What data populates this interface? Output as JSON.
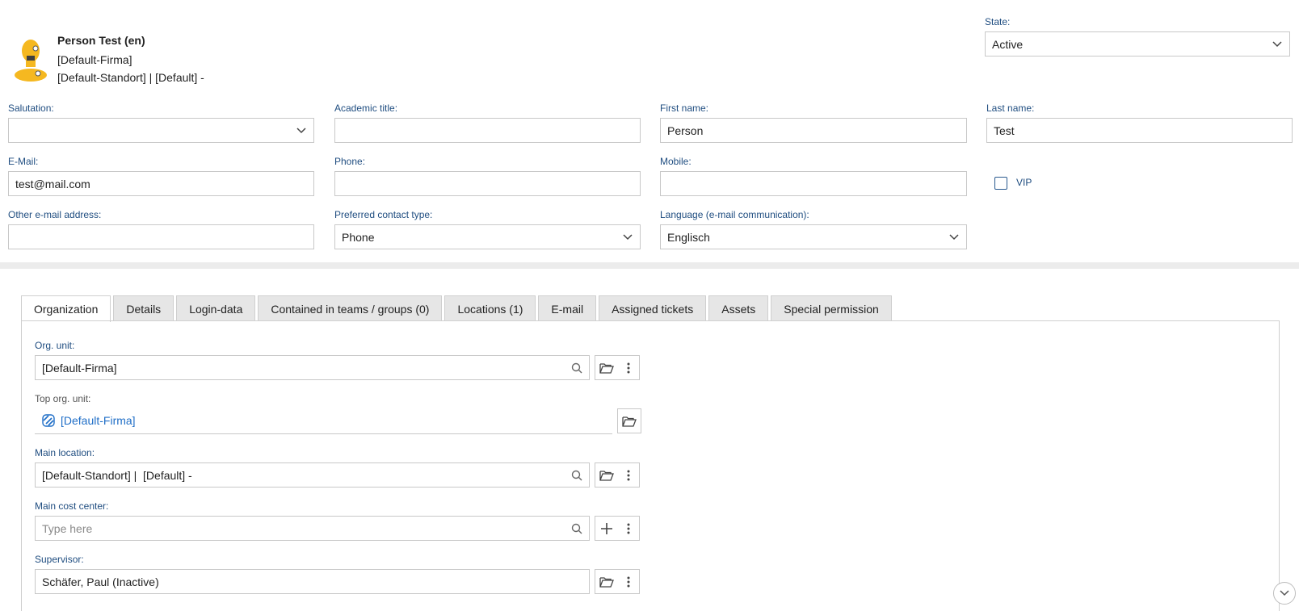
{
  "person": {
    "name": "Person Test (en)",
    "company": "[Default-Firma]",
    "location": "[Default-Standort] | [Default] -"
  },
  "state": {
    "label": "State:",
    "value": "Active"
  },
  "form": {
    "salutation": {
      "label": "Salutation:",
      "value": ""
    },
    "academic_title": {
      "label": "Academic title:",
      "value": ""
    },
    "first_name": {
      "label": "First name:",
      "value": "Person"
    },
    "last_name": {
      "label": "Last name:",
      "value": "Test"
    },
    "email": {
      "label": "E-Mail:",
      "value": "test@mail.com"
    },
    "phone": {
      "label": "Phone:",
      "value": ""
    },
    "mobile": {
      "label": "Mobile:",
      "value": ""
    },
    "vip": {
      "label": "VIP",
      "checked": false
    },
    "other_email": {
      "label": "Other e-mail address:",
      "value": ""
    },
    "preferred_contact": {
      "label": "Preferred contact type:",
      "value": "Phone"
    },
    "language": {
      "label": "Language (e-mail communication):",
      "value": "Englisch"
    }
  },
  "tabs": [
    {
      "label": "Organization",
      "active": true
    },
    {
      "label": "Details"
    },
    {
      "label": "Login-data"
    },
    {
      "label": "Contained in teams / groups (0)"
    },
    {
      "label": "Locations (1)"
    },
    {
      "label": "E-mail"
    },
    {
      "label": "Assigned tickets"
    },
    {
      "label": "Assets"
    },
    {
      "label": "Special permission"
    }
  ],
  "organization": {
    "org_unit": {
      "label": "Org. unit:",
      "value": "[Default-Firma]"
    },
    "top_org_unit": {
      "label": "Top org. unit:",
      "value": "[Default-Firma]"
    },
    "main_location": {
      "label": "Main location:",
      "value": "[Default-Standort] |  [Default] -"
    },
    "main_cost_center": {
      "label": "Main cost center:",
      "placeholder": "Type here"
    },
    "supervisor": {
      "label": "Supervisor:",
      "value": "Schäfer, Paul (Inactive)"
    }
  },
  "colors": {
    "label": "#1f4d80",
    "link": "#1f6ec7",
    "avatar": "#f5b820",
    "border": "#c8c8c8"
  },
  "icons": [
    "person-avatar-icon",
    "chevron-down-icon",
    "search-icon",
    "folder-open-icon",
    "more-vertical-icon",
    "plus-icon",
    "org-link-icon",
    "scroll-down-icon"
  ]
}
